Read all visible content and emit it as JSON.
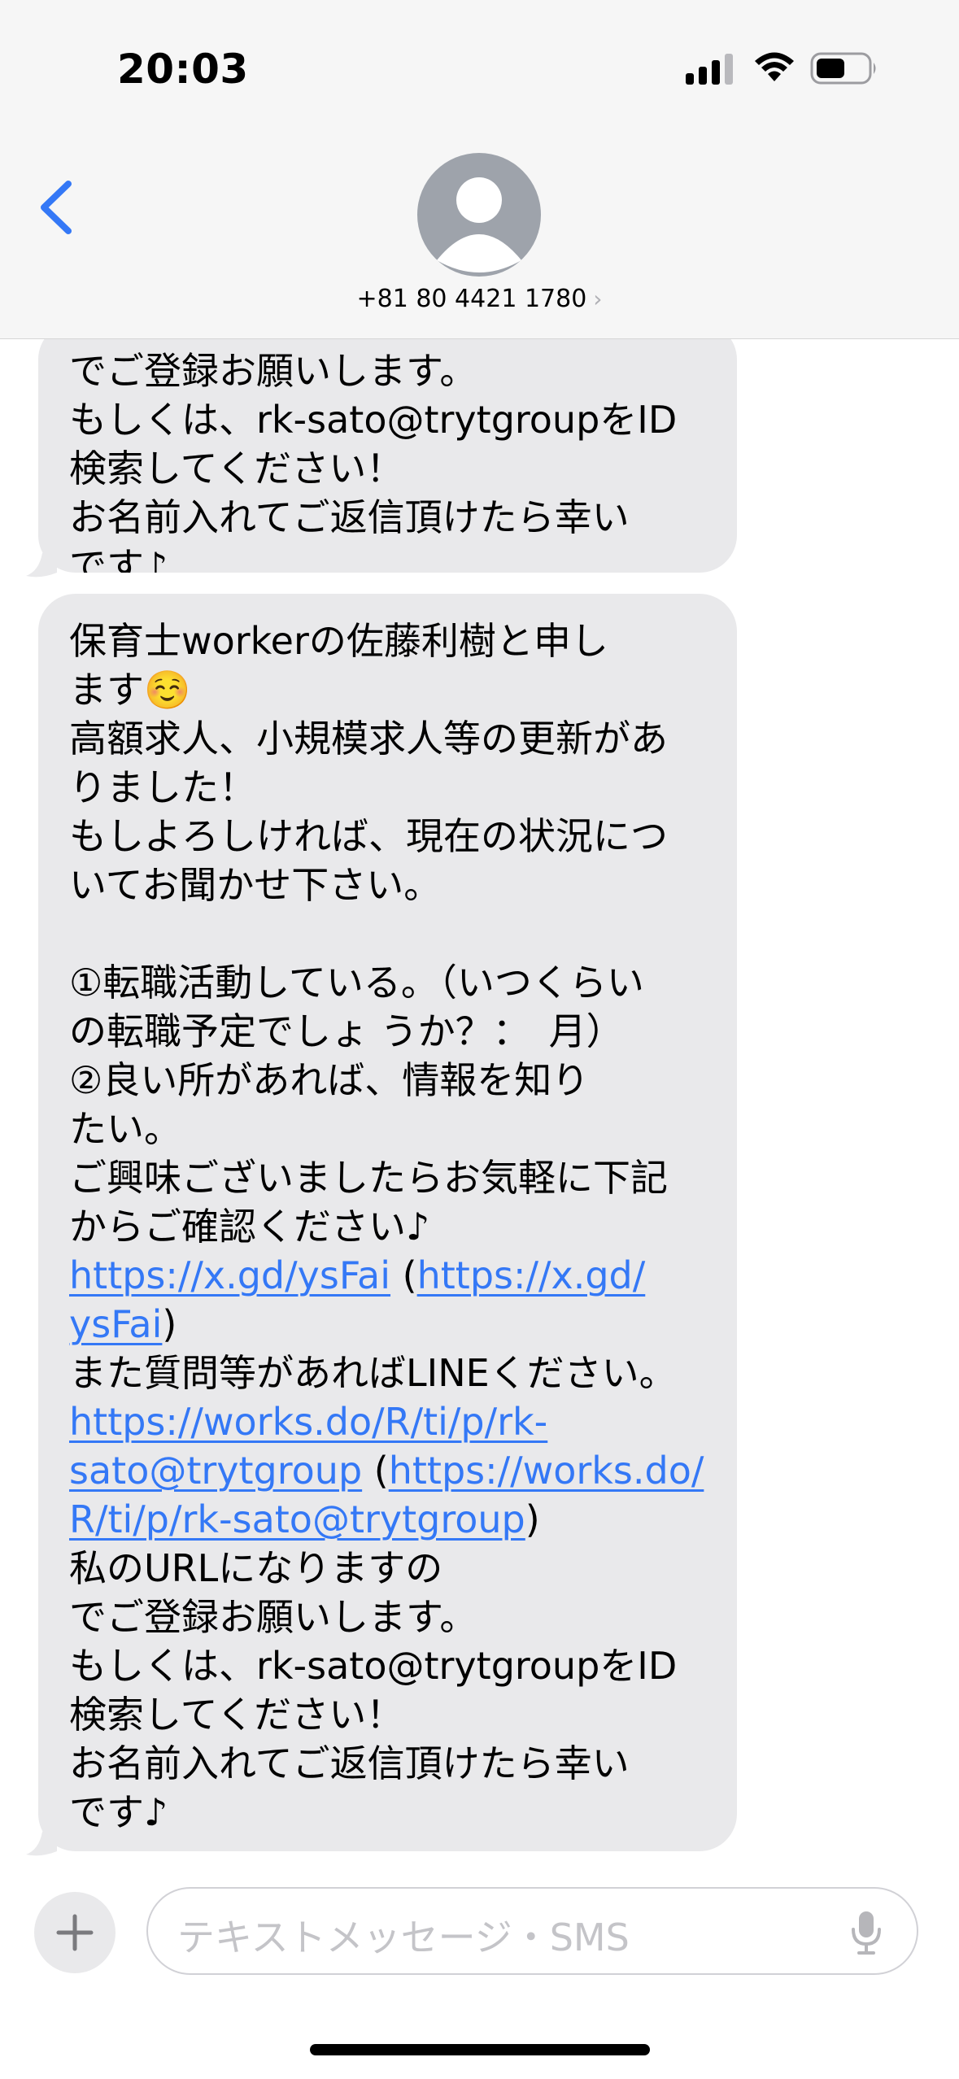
{
  "status_bar": {
    "time": "20:03"
  },
  "header": {
    "contact_number": "+81 80 4421 1780",
    "chevron": "›"
  },
  "messages": {
    "previous": {
      "lines": [
        "でご登録お願いします。",
        "もしくは、rk-sato@trytgroupをID",
        "検索してください！",
        "お名前入れてご返信頂けたら幸い",
        "です♪"
      ]
    },
    "main": {
      "l1": "保育士workerの佐藤利樹と申し",
      "l2": "ます☺️",
      "l3": "高額求人、小規模求人等の更新があ",
      "l4": "りました！",
      "l5": "もしよろしければ、現在の状況につ",
      "l6": "いてお聞かせ下さい。",
      "l7": "①転職活動している。（いつくらい",
      "l8": "の転職予定でしょ うか？：　月）",
      "l9": "②良い所があれば、情報を知り",
      "l10": "たい。",
      "l11": "ご興味ございましたらお気軽に下記",
      "l12": "からご確認ください♪",
      "link1a": "https://x.gd/ysFai",
      "link1b_part1": "https://x.gd/",
      "link1b_part2": "ysFai",
      "l15": "また質問等があればLINEください。",
      "link2a_part1": "https://works.do/R/ti/p/rk-",
      "link2a_part2": "sato@trytgroup",
      "link2b_part1": "https://works.do/",
      "link2b_part2": "R/ti/p/rk-sato@trytgroup",
      "l19": "私のURLになりますの",
      "l20": "でご登録お願いします。",
      "l21": "もしくは、rk-sato@trytgroupをID",
      "l22": "検索してください！",
      "l23": "お名前入れてご返信頂けたら幸い",
      "l24": "です♪",
      "paren_open": " (",
      "paren_close": ")"
    }
  },
  "input_bar": {
    "placeholder": "テキストメッセージ・SMS"
  },
  "icons": {
    "back": "chevron-left-icon",
    "avatar": "person-icon",
    "plus": "plus-icon",
    "mic": "microphone-icon",
    "signal": "cellular-signal-icon",
    "wifi": "wifi-icon",
    "battery": "battery-icon"
  },
  "colors": {
    "accent": "#3478f6",
    "bubble": "#e9e9eb",
    "link": "#3478f6"
  }
}
